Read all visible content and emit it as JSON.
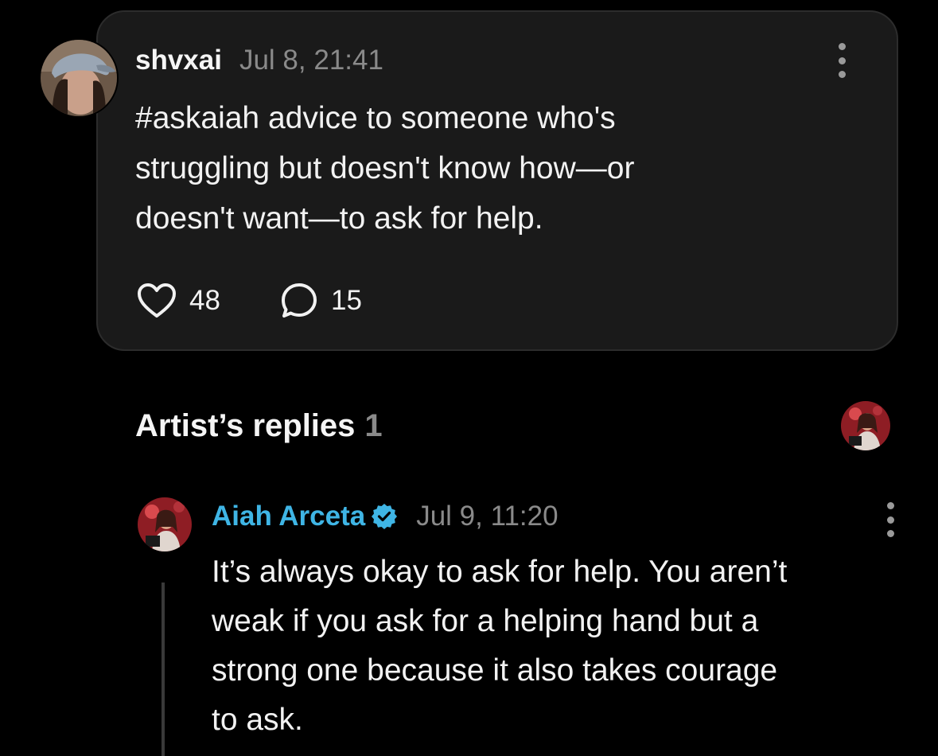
{
  "post": {
    "username": "shvxai",
    "timestamp": "Jul 8, 21:41",
    "text_lines": [
      "#askaiah advice to someone who's",
      "struggling but doesn't know how—or",
      "doesn't want—to ask for help."
    ],
    "likes": "48",
    "comments": "15",
    "icons": {
      "like": "heart-outline-icon",
      "comment": "speech-bubble-icon",
      "more": "vertical-ellipsis-icon"
    }
  },
  "artist_replies": {
    "title": "Artist’s replies",
    "count": "1",
    "reply": {
      "author": "Aiah Arceta",
      "verified": true,
      "timestamp": "Jul 9, 11:20",
      "text_lines": [
        "It’s always okay to ask for help. You aren’t",
        "weak if you ask for a helping hand but a",
        "strong one because it also takes courage",
        "to ask."
      ]
    }
  },
  "colors": {
    "background": "#000000",
    "card": "#1a1a1a",
    "card_border": "#2c2c2c",
    "text_primary": "#f2f2f2",
    "text_muted": "#8a8a8a",
    "artist_name": "#3fb5e5",
    "verified_badge": "#3fb5e5"
  }
}
